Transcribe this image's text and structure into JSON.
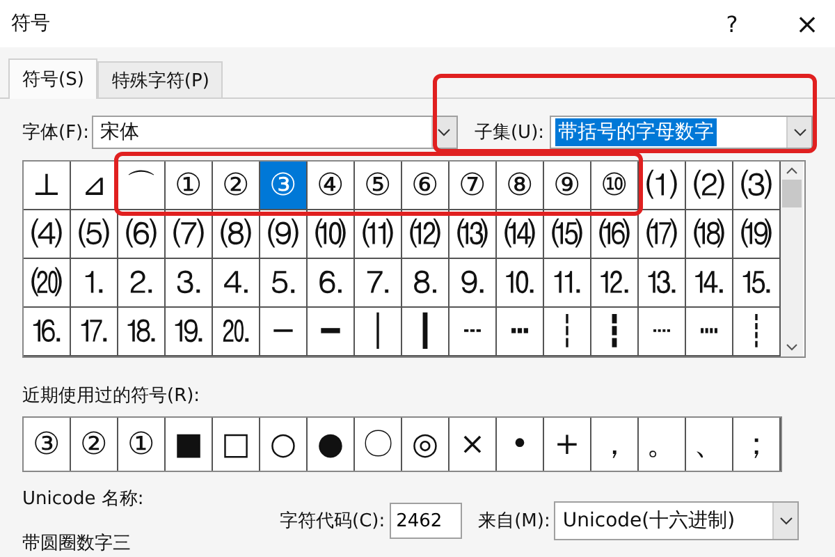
{
  "window": {
    "title": "符号",
    "help": "?",
    "close": "×"
  },
  "tabs": [
    {
      "label": "符号(S)",
      "selected": true
    },
    {
      "label": "特殊字符(P)",
      "selected": false
    }
  ],
  "font": {
    "label": "字体(F):",
    "value": "宋体"
  },
  "subset": {
    "label": "子集(U):",
    "value": "带括号的字母数字",
    "highlighted": true
  },
  "symbol_grid": {
    "rows": [
      {
        "runs": [
          {
            "highlighted": false,
            "cells": [
              {
                "char": "⊥",
                "selected": false
              },
              {
                "char": "⊿",
                "selected": false
              }
            ]
          },
          {
            "highlighted": true,
            "cells": [
              {
                "char": "⌒",
                "selected": false
              },
              {
                "char": "①",
                "selected": false
              },
              {
                "char": "②",
                "selected": false
              },
              {
                "char": "③",
                "selected": true
              },
              {
                "char": "④",
                "selected": false
              },
              {
                "char": "⑤",
                "selected": false
              },
              {
                "char": "⑥",
                "selected": false
              },
              {
                "char": "⑦",
                "selected": false
              },
              {
                "char": "⑧",
                "selected": false
              },
              {
                "char": "⑨",
                "selected": false
              },
              {
                "char": "⑩",
                "selected": false
              }
            ]
          },
          {
            "highlighted": false,
            "cells": [
              {
                "char": "⑴",
                "selected": false
              },
              {
                "char": "⑵",
                "selected": false
              },
              {
                "char": "⑶",
                "selected": false
              }
            ]
          }
        ]
      },
      {
        "runs": [
          {
            "highlighted": false,
            "cells": [
              {
                "char": "⑷",
                "selected": false
              },
              {
                "char": "⑸",
                "selected": false
              },
              {
                "char": "⑹",
                "selected": false
              },
              {
                "char": "⑺",
                "selected": false
              },
              {
                "char": "⑻",
                "selected": false
              },
              {
                "char": "⑼",
                "selected": false
              },
              {
                "char": "⑽",
                "selected": false
              },
              {
                "char": "⑾",
                "selected": false
              },
              {
                "char": "⑿",
                "selected": false
              },
              {
                "char": "⒀",
                "selected": false
              },
              {
                "char": "⒁",
                "selected": false
              },
              {
                "char": "⒂",
                "selected": false
              },
              {
                "char": "⒃",
                "selected": false
              },
              {
                "char": "⒄",
                "selected": false
              },
              {
                "char": "⒅",
                "selected": false
              },
              {
                "char": "⒆",
                "selected": false
              }
            ]
          }
        ]
      },
      {
        "runs": [
          {
            "highlighted": false,
            "cells": [
              {
                "char": "⒇",
                "selected": false
              },
              {
                "char": "⒈",
                "selected": false
              },
              {
                "char": "⒉",
                "selected": false
              },
              {
                "char": "⒊",
                "selected": false
              },
              {
                "char": "⒋",
                "selected": false
              },
              {
                "char": "⒌",
                "selected": false
              },
              {
                "char": "⒍",
                "selected": false
              },
              {
                "char": "⒎",
                "selected": false
              },
              {
                "char": "⒏",
                "selected": false
              },
              {
                "char": "⒐",
                "selected": false
              },
              {
                "char": "⒑",
                "selected": false
              },
              {
                "char": "⒒",
                "selected": false
              },
              {
                "char": "⒓",
                "selected": false
              },
              {
                "char": "⒔",
                "selected": false
              },
              {
                "char": "⒕",
                "selected": false
              },
              {
                "char": "⒖",
                "selected": false
              }
            ]
          }
        ]
      },
      {
        "runs": [
          {
            "highlighted": false,
            "cells": [
              {
                "char": "⒗",
                "selected": false
              },
              {
                "char": "⒘",
                "selected": false
              },
              {
                "char": "⒙",
                "selected": false
              },
              {
                "char": "⒚",
                "selected": false
              },
              {
                "char": "⒛",
                "selected": false
              },
              {
                "char": "─",
                "selected": false
              },
              {
                "char": "━",
                "selected": false
              },
              {
                "char": "│",
                "selected": false
              },
              {
                "char": "┃",
                "selected": false
              },
              {
                "char": "┄",
                "selected": false
              },
              {
                "char": "┅",
                "selected": false
              },
              {
                "char": "┆",
                "selected": false
              },
              {
                "char": "┇",
                "selected": false
              },
              {
                "char": "┈",
                "selected": false
              },
              {
                "char": "┉",
                "selected": false
              },
              {
                "char": "┊",
                "selected": false
              }
            ]
          }
        ]
      }
    ]
  },
  "recent": {
    "label": "近期使用过的符号(R):",
    "symbols": [
      "③",
      "②",
      "①",
      "■",
      "□",
      "○",
      "●",
      "〇",
      "◎",
      "×",
      "•",
      "+",
      "，",
      "。",
      "、",
      "；"
    ]
  },
  "unicode_name": {
    "label": "Unicode 名称:",
    "value": "带圆圈数字三"
  },
  "char_code": {
    "label": "字符代码(C):",
    "value": "2462"
  },
  "from": {
    "label": "来自(M):",
    "value": "Unicode(十六进制)"
  }
}
